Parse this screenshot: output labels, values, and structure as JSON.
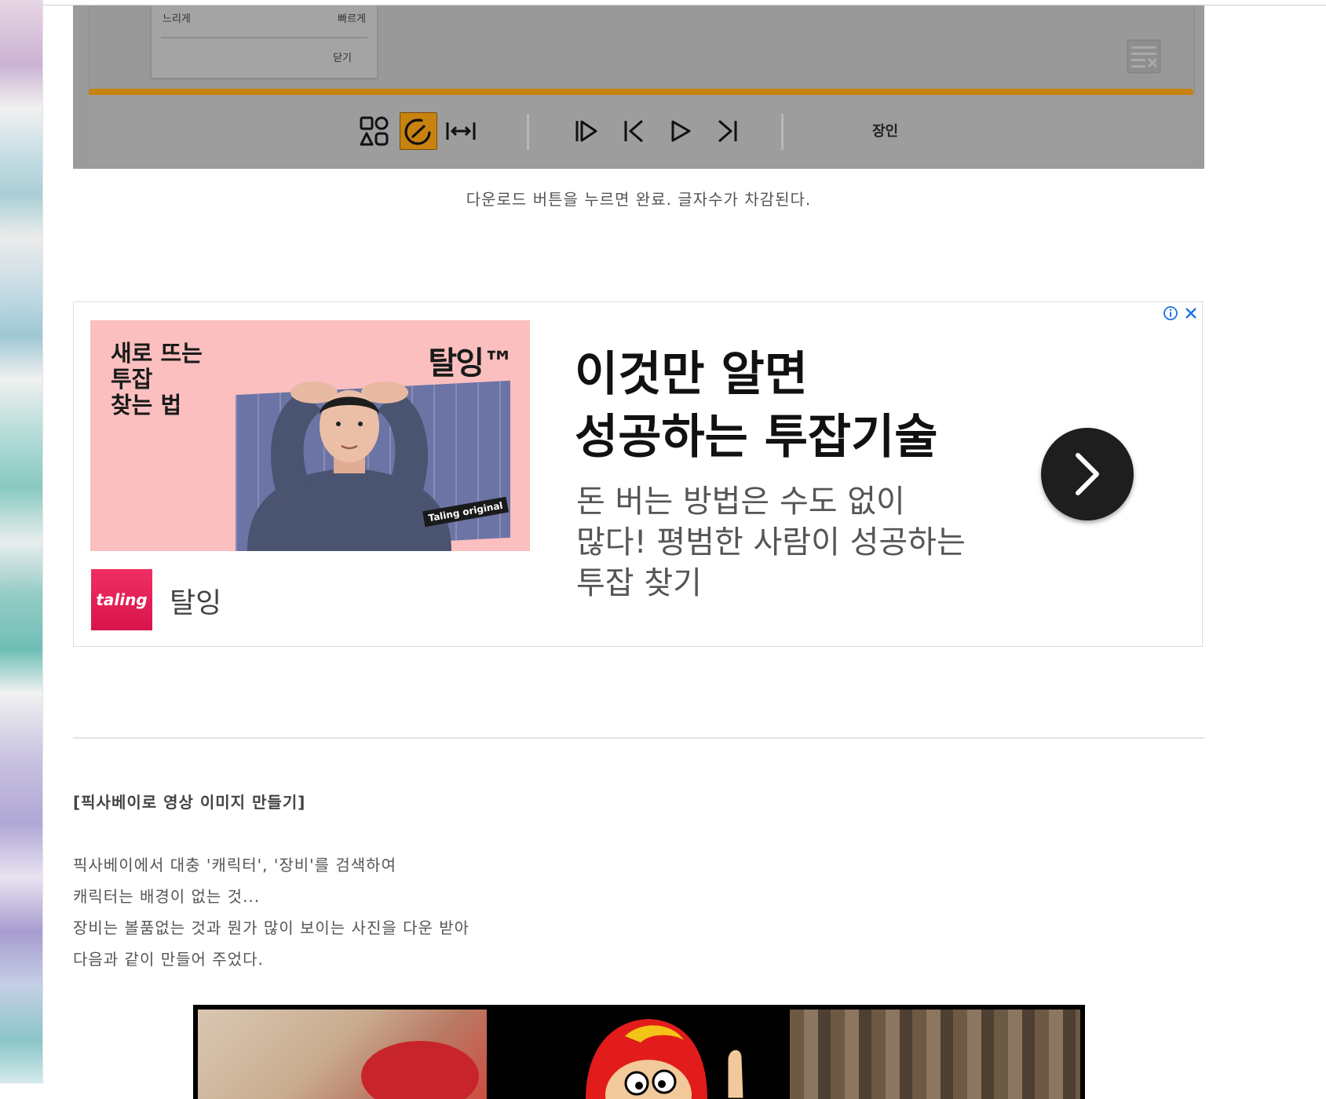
{
  "player": {
    "speed_menu": {
      "slow_label": "느리게",
      "fast_label": "빠르게",
      "close_label": "닫기"
    },
    "master_label": "장인",
    "accent_color": "#c8820f",
    "icons": {
      "grid": "grid-shapes-icon",
      "speed": "speedometer-icon",
      "width": "width-arrows-icon",
      "list_close": "list-close-icon",
      "prev_section": "skip-start-icon",
      "prev": "previous-icon",
      "play": "play-icon",
      "next": "next-icon"
    }
  },
  "caption": "다운로드 버튼을 누르면 완료. 글자수가 차감된다.",
  "ad": {
    "image_copy": "새로 뜨는\n투잡\n찾는 법",
    "image_brand": "탈잉™",
    "image_tag": "Taling original",
    "logo_text": "taling",
    "brand_name": "탈잉",
    "title": "이것만 알면\n성공하는 투잡기술",
    "description": "돈 버는 방법은 수도 없이\n많다! 평범한 사람이 성공하는\n투잡 찾기",
    "brand_color": "#e8245a"
  },
  "article": {
    "section_title": "[픽사베이로 영상 이미지 만들기]",
    "lines": [
      "픽사베이에서 대충 '캐릭터', '장비'를 검색하여",
      "캐릭터는 배경이 없는 것...",
      "장비는 볼품없는 것과 뭔가 많이 보이는 사진을 다운 받아",
      "다음과 같이 만들어 주었다."
    ]
  }
}
